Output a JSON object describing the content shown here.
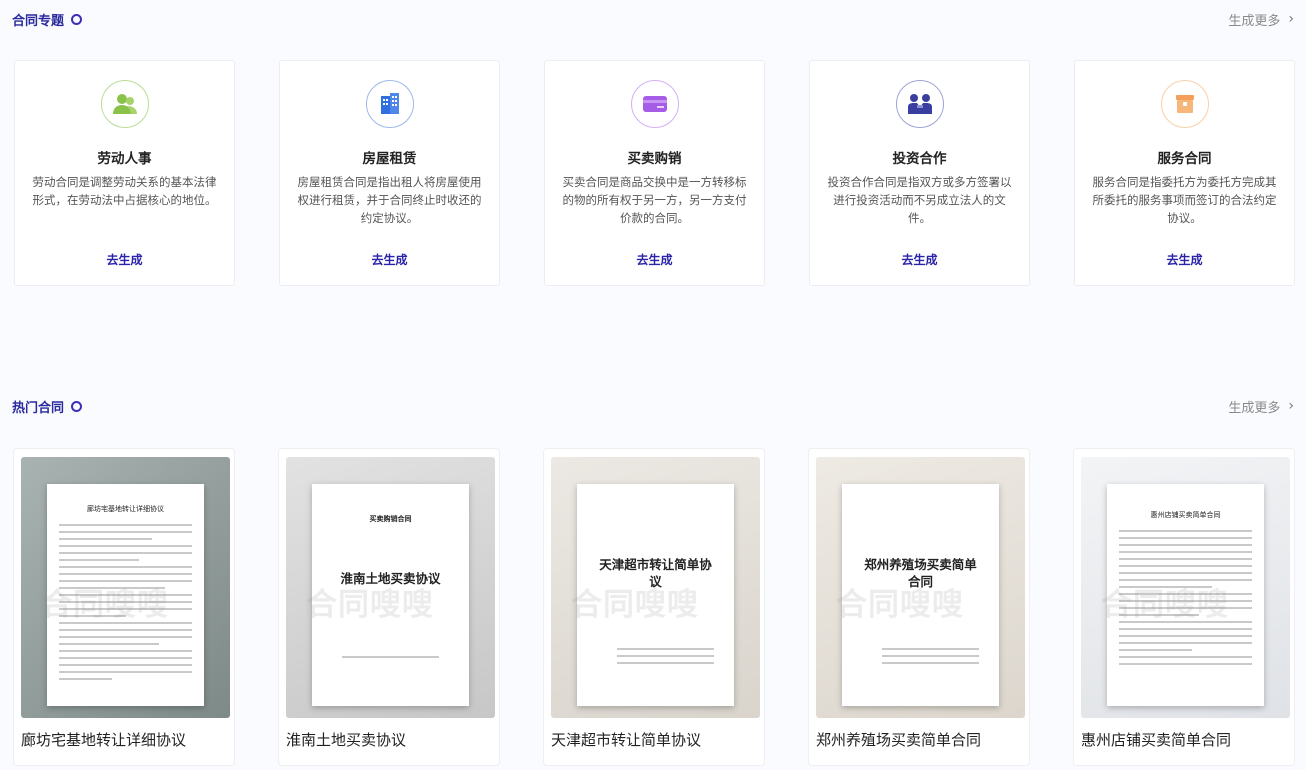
{
  "topics_section": {
    "title": "合同专题",
    "more": "生成更多"
  },
  "topics": [
    {
      "title": "劳动人事",
      "desc": "劳动合同是调整劳动关系的基本法律形式，在劳动法中占据核心的地位。",
      "link": "去生成",
      "icon": "people-icon",
      "color": "#8bc34a"
    },
    {
      "title": "房屋租赁",
      "desc": "房屋租赁合同是指出租人将房屋使用权进行租赁，并于合同终止时收还的约定协议。",
      "link": "去生成",
      "icon": "building-icon",
      "color": "#2f6fe0"
    },
    {
      "title": "买卖购销",
      "desc": "买卖合同是商品交换中是一方转移标的物的所有权于另一方，另一方支付价款的合同。",
      "link": "去生成",
      "icon": "card-icon",
      "color": "#a55ce6"
    },
    {
      "title": "投资合作",
      "desc": "投资合作合同是指双方或多方签署以进行投资活动而不另成立法人的文件。",
      "link": "去生成",
      "icon": "handshake-icon",
      "color": "#3a3f9f"
    },
    {
      "title": "服务合同",
      "desc": "服务合同是指委托方为委托方完成其所委托的服务事项而签订的合法约定协议。",
      "link": "去生成",
      "icon": "box-icon",
      "color": "#f5a05a"
    }
  ],
  "hot_section": {
    "title": "热门合同",
    "more": "生成更多"
  },
  "hot": [
    {
      "title": "廊坊宅基地转让详细协议",
      "doc_heading": "廊坊宅基地转让详细协议",
      "doc_big": "",
      "bg": "#8f9a98"
    },
    {
      "title": "淮南土地买卖协议",
      "doc_heading": "买卖购销合同",
      "doc_big": "淮南土地买卖协议",
      "bg": "#d8d8d8"
    },
    {
      "title": "天津超市转让简单协议",
      "doc_heading": "",
      "doc_big": "天津超市转让简单协议",
      "bg": "#e6e3de"
    },
    {
      "title": "郑州养殖场买卖简单合同",
      "doc_heading": "",
      "doc_big": "郑州养殖场买卖简单合同",
      "bg": "#e8e4de"
    },
    {
      "title": "惠州店铺买卖简单合同",
      "doc_heading": "惠州店铺买卖简单合同",
      "doc_big": "",
      "bg": "#eef0f2"
    }
  ],
  "watermark": "合同嗖嗖"
}
